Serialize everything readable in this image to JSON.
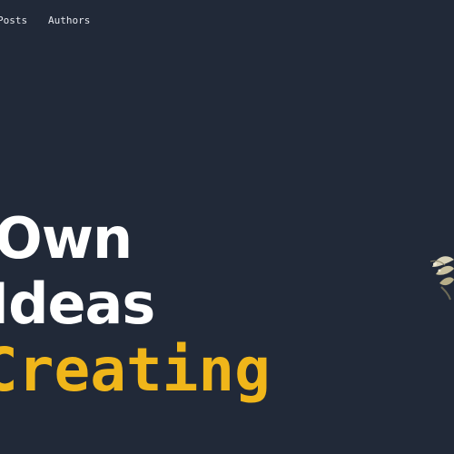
{
  "nav": {
    "items": [
      {
        "label": "Posts"
      },
      {
        "label": "Authors"
      }
    ]
  },
  "hero": {
    "lines": [
      {
        "text": "Own"
      },
      {
        "text": "Ideas"
      },
      {
        "text": "Creating"
      }
    ]
  },
  "colors": {
    "background": "#212938",
    "accent": "#f0b61a",
    "text": "#ffffff"
  },
  "decor": {
    "icon": "plant-sprig-icon"
  }
}
